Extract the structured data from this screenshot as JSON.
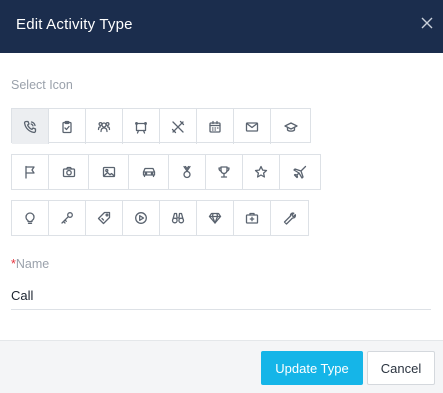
{
  "dialog": {
    "title": "Edit Activity Type",
    "close_icon": "close-icon"
  },
  "icon_picker": {
    "label": "Select Icon",
    "selected": "phone-icon",
    "rows": [
      [
        "phone-icon",
        "clipboard-check-icon",
        "users-group-icon",
        "pin-board-icon",
        "cutlery-icon",
        "calendar-icon",
        "envelope-icon",
        "mortarboard-icon"
      ],
      [
        "flag-icon",
        "camera-icon",
        "image-icon",
        "car-icon",
        "medal-icon",
        "trophy-icon",
        "star-icon",
        "airplane-icon"
      ],
      [
        "lightbulb-icon",
        "key-icon",
        "tag-icon",
        "play-circle-icon",
        "binoculars-icon",
        "diamond-icon",
        "briefcase-medical-icon",
        "wrench-icon"
      ]
    ]
  },
  "name_field": {
    "required_mark": "*",
    "label": "Name",
    "value": "Call"
  },
  "footer": {
    "submit_label": "Update Type",
    "cancel_label": "Cancel"
  },
  "colors": {
    "header_bg": "#1b2d4d",
    "primary": "#15b5e8",
    "required": "#e5323c"
  }
}
